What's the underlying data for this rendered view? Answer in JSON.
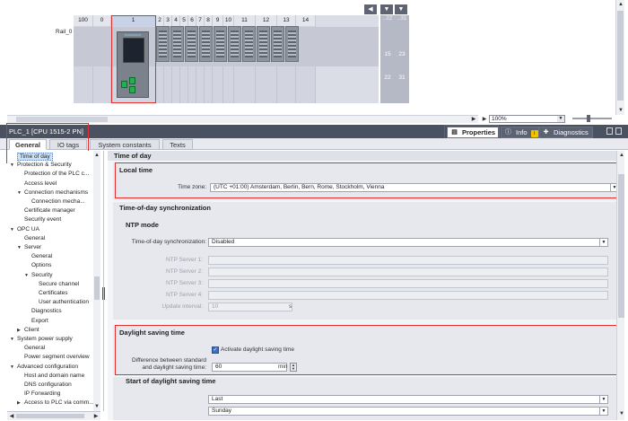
{
  "device_view": {
    "slot_numbers": [
      "100",
      "0",
      "1",
      "2",
      "3",
      "4",
      "5",
      "6",
      "7",
      "8",
      "9",
      "10",
      "11",
      "12",
      "13",
      "14"
    ],
    "rail_label": "Rail_0",
    "rack_numbers_left": [
      "15",
      "22"
    ],
    "rack_numbers_right": [
      "23",
      "31"
    ],
    "rack_header_left": "..22",
    "rack_header_right": "..31",
    "zoom": "100%"
  },
  "inspector": {
    "title": "PLC_1 [CPU 1515-2 PN]",
    "tabs": [
      {
        "label": "Properties",
        "icon": "properties-icon"
      },
      {
        "label": "Info",
        "icon": "info-icon"
      },
      {
        "label": "Diagnostics",
        "icon": "diagnostics-icon"
      }
    ],
    "info_badge": "i"
  },
  "subtabs": [
    "General",
    "IO tags",
    "System constants",
    "Texts"
  ],
  "tree": [
    {
      "label": "Time of day",
      "level": 0,
      "arrow": "",
      "selected": true
    },
    {
      "label": "Protection & Security",
      "level": 0,
      "arrow": "▼"
    },
    {
      "label": "Protection of the PLC c...",
      "level": 1,
      "arrow": ""
    },
    {
      "label": "Access level",
      "level": 1,
      "arrow": ""
    },
    {
      "label": "Connection mechanisms",
      "level": 1,
      "arrow": "▼"
    },
    {
      "label": "Connection mecha...",
      "level": 2,
      "arrow": ""
    },
    {
      "label": "Certificate manager",
      "level": 1,
      "arrow": ""
    },
    {
      "label": "Security event",
      "level": 1,
      "arrow": ""
    },
    {
      "label": "OPC UA",
      "level": 0,
      "arrow": "▼"
    },
    {
      "label": "General",
      "level": 1,
      "arrow": ""
    },
    {
      "label": "Server",
      "level": 1,
      "arrow": "▼"
    },
    {
      "label": "General",
      "level": 2,
      "arrow": ""
    },
    {
      "label": "Options",
      "level": 2,
      "arrow": ""
    },
    {
      "label": "Security",
      "level": 2,
      "arrow": "▼"
    },
    {
      "label": "Secure channel",
      "level": 3,
      "arrow": ""
    },
    {
      "label": "Certificates",
      "level": 3,
      "arrow": ""
    },
    {
      "label": "User authentication",
      "level": 3,
      "arrow": ""
    },
    {
      "label": "Diagnostics",
      "level": 2,
      "arrow": ""
    },
    {
      "label": "Export",
      "level": 2,
      "arrow": ""
    },
    {
      "label": "Client",
      "level": 1,
      "arrow": "▶"
    },
    {
      "label": "System power supply",
      "level": 0,
      "arrow": "▼"
    },
    {
      "label": "General",
      "level": 1,
      "arrow": ""
    },
    {
      "label": "Power segment overview",
      "level": 1,
      "arrow": ""
    },
    {
      "label": "Advanced configuration",
      "level": 0,
      "arrow": "▼"
    },
    {
      "label": "Host and domain name",
      "level": 1,
      "arrow": ""
    },
    {
      "label": "DNS configuration",
      "level": 1,
      "arrow": ""
    },
    {
      "label": "IP Forwarding",
      "level": 1,
      "arrow": ""
    },
    {
      "label": "Access to PLC via comm...",
      "level": 1,
      "arrow": "▶"
    }
  ],
  "panel": {
    "header": "Time of day",
    "local_time": {
      "title": "Local time",
      "timezone_label": "Time zone:",
      "timezone_value": "(UTC +01:00) Amsterdam, Berlin, Bern, Rome, Stockholm, Vienna"
    },
    "sync": {
      "title": "Time-of-day synchronization",
      "ntp_title": "NTP mode",
      "sync_label": "Time-of-day synchronization:",
      "sync_value": "Disabled",
      "ntp_servers": [
        "NTP Server 1:",
        "NTP Server 2:",
        "NTP Server 3:",
        "NTP Server 4:"
      ],
      "update_label": "Update interval:",
      "update_value": "10",
      "update_unit": "s"
    },
    "dst": {
      "title": "Daylight saving time",
      "activate_label": "Activate daylight saving time",
      "diff_label_1": "Difference between standard",
      "diff_label_2": "and daylight saving time:",
      "diff_value": "60",
      "diff_unit": "min"
    },
    "dst_start": {
      "title": "Start of daylight saving time",
      "week_value": "Last",
      "day_value": "Sunday"
    }
  }
}
